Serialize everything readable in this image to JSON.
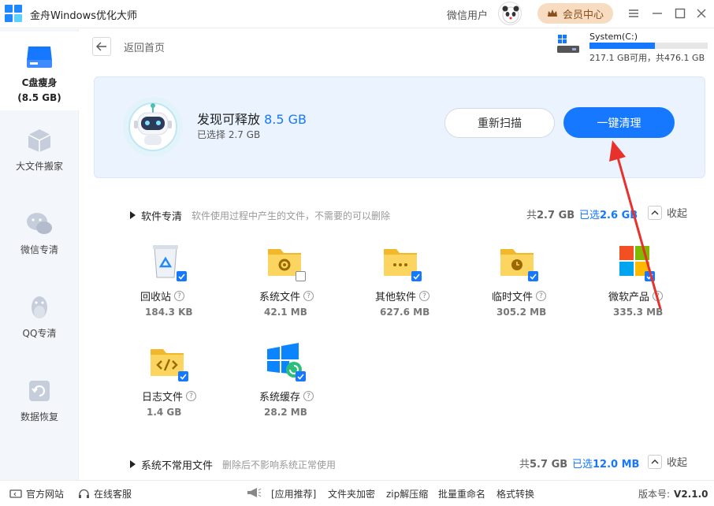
{
  "titlebar": {
    "app_title": "金舟Windows优化大师",
    "user_name": "微信用户",
    "vip_label": "会员中心"
  },
  "sidebar": {
    "items": [
      {
        "label": "C盘瘦身",
        "sub": "(8.5 GB)"
      },
      {
        "label": "大文件搬家"
      },
      {
        "label": "微信专清"
      },
      {
        "label": "QQ专清"
      },
      {
        "label": "数据恢复"
      }
    ]
  },
  "header": {
    "back_label": "返回首页",
    "drive_name": "System(C:)",
    "drive_usage_fraction": 0.55,
    "drive_info": "217.1 GB可用，共476.1 GB"
  },
  "summary": {
    "found_prefix": "发现可释放",
    "found_size": "8.5 GB",
    "selected": "已选择 2.7 GB",
    "rescan_label": "重新扫描",
    "clean_label": "一键清理"
  },
  "sections": [
    {
      "title": "软件专清",
      "desc": "软件使用过程中产生的文件，不需要的可以删除",
      "total_prefix": "共",
      "total": "2.7 GB",
      "sel_prefix": "已选",
      "selected": "2.6 GB",
      "collapse_label": "收起",
      "items": [
        {
          "name": "回收站",
          "size": "184.3 KB",
          "checked": true,
          "icon": "recycle-bin-icon"
        },
        {
          "name": "系统文件",
          "size": "42.1 MB",
          "checked": false,
          "icon": "system-folder-icon"
        },
        {
          "name": "其他软件",
          "size": "627.6 MB",
          "checked": true,
          "icon": "other-folder-icon"
        },
        {
          "name": "临时文件",
          "size": "305.2 MB",
          "checked": true,
          "icon": "temp-folder-icon"
        },
        {
          "name": "微软产品",
          "size": "335.3 MB",
          "checked": true,
          "icon": "microsoft-logo-icon"
        },
        {
          "name": "日志文件",
          "size": "1.4 GB",
          "checked": true,
          "icon": "log-folder-icon"
        },
        {
          "name": "系统缓存",
          "size": "28.2 MB",
          "checked": true,
          "icon": "system-cache-icon"
        }
      ]
    },
    {
      "title": "系统不常用文件",
      "desc": "删除后不影响系统正常使用",
      "total_prefix": "共",
      "total": "5.7 GB",
      "sel_prefix": "已选",
      "selected": "12.0 MB",
      "collapse_label": "收起"
    }
  ],
  "footer": {
    "website": "官方网站",
    "support": "在线客服",
    "recommend": "[应用推荐]",
    "encrypt": "文件夹加密",
    "unzip": "zip解压缩",
    "rename": "批量重命名",
    "convert": "格式转换",
    "version_label": "版本号:",
    "version": "V2.1.0"
  },
  "colors": {
    "accent": "#1677ff",
    "vip_bg": "#f7dcc1",
    "annotation_arrow": "#e8312c"
  }
}
